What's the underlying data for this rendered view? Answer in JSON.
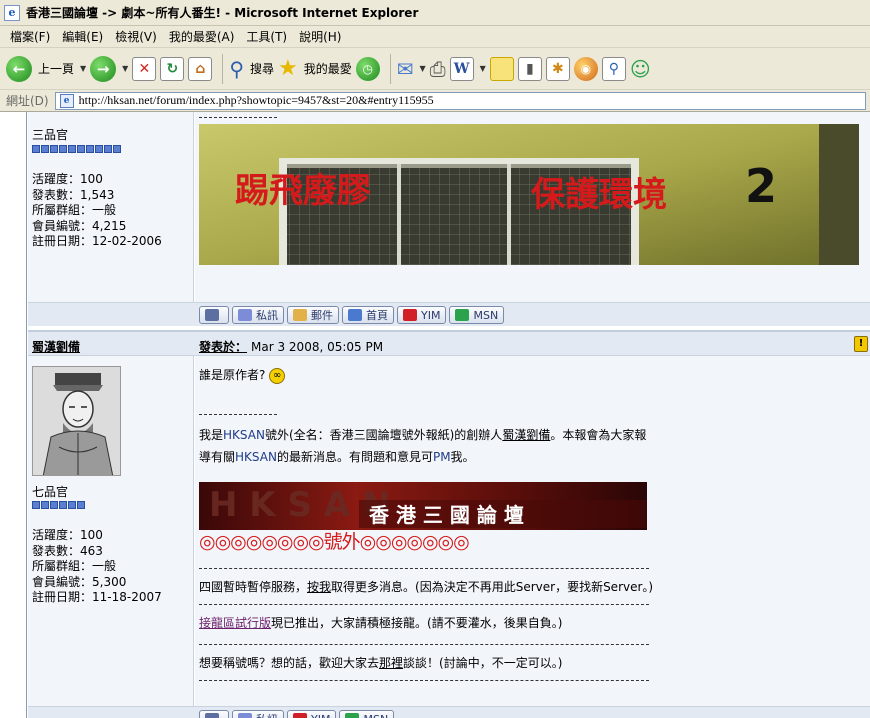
{
  "window": {
    "title": "香港三國論壇 -> 劇本~所有人番生! - Microsoft Internet Explorer"
  },
  "menu": {
    "items": [
      "檔案(F)",
      "編輯(E)",
      "檢視(V)",
      "我的最愛(A)",
      "工具(T)",
      "說明(H)"
    ]
  },
  "toolbar": {
    "back_label": "上一頁",
    "search_label": "搜尋",
    "favorites_label": "我的最愛"
  },
  "address": {
    "label": "網址(D)",
    "url": "http://hksan.net/forum/index.php?showtopic=9457&st=20&#entry115955"
  },
  "post1": {
    "rank": "三品官",
    "pips": 10,
    "stats": [
      {
        "k": "活躍度：",
        "v": "100"
      },
      {
        "k": "發表數：",
        "v": "1,543"
      },
      {
        "k": "所屬群組：",
        "v": "一般"
      },
      {
        "k": "會員編號：",
        "v": "4,215"
      },
      {
        "k": "註冊日期：",
        "v": "12-02-2006"
      }
    ],
    "banner": {
      "left_text": "踢飛廢膠",
      "right_text": "保護環境",
      "number": "2"
    }
  },
  "footer_buttons": {
    "pm": "私訊",
    "mail": "郵件",
    "home": "首頁",
    "yim": "YIM",
    "msn": "MSN"
  },
  "post2": {
    "username": "蜀漢劉備",
    "posted_label": "發表於：",
    "date": "Mar 3 2008, 05:05 PM",
    "rank": "七品官",
    "pips": 6,
    "stats": [
      {
        "k": "活躍度：",
        "v": "100"
      },
      {
        "k": "發表數：",
        "v": "463"
      },
      {
        "k": "所屬群組：",
        "v": "一般"
      },
      {
        "k": "會員編號：",
        "v": "5,300"
      },
      {
        "k": "註冊日期：",
        "v": "11-18-2007"
      }
    ],
    "message": "誰是原作者?",
    "sig": {
      "line1a": "我是",
      "line1b": "HKSAN",
      "line1c": "號外(全名：香港三國論壇號外報紙)的創辦人",
      "line1d": "蜀漢劉備",
      "line1e": "。本報會為大家報",
      "line2a": "導有關",
      "line2b": "HKSAN",
      "line2c": "的最新消息。有問題和意見可",
      "line2d": "PM",
      "line2e": "我。",
      "banner_text": "香 港 三 國 論 壇",
      "banner_bg": "H K S A N",
      "circles_left": "◎◎◎◎◎◎◎◎",
      "haowai": "號外",
      "circles_right": "◎◎◎◎◎◎◎",
      "notice1a": "四國暫時暫停服務，",
      "notice1b": "按我",
      "notice1c": "取得更多消息。(因為決定不再用此Server，要找新Server。)",
      "notice2a": "接龍區試行版",
      "notice2b": "現已推出，大家請積極接龍。(請不要灌水，後果自負。)",
      "notice3a": "想要稱號嗎？想的話，歡迎大家去",
      "notice3b": "那裡",
      "notice3c": "談談！(討論中，不一定可以。)"
    }
  }
}
